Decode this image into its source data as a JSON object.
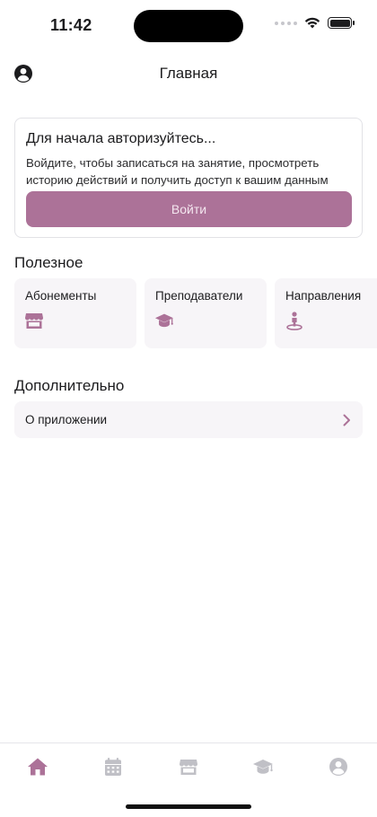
{
  "status_bar": {
    "time": "11:42"
  },
  "nav": {
    "title": "Главная",
    "profile_icon": "person-circle-icon"
  },
  "auth_card": {
    "title": "Для начала авторизуйтесь...",
    "description": "Войдите, чтобы записаться на занятие, просмотреть историю действий и получить доступ к вашим данным",
    "button_label": "Войти"
  },
  "useful": {
    "heading": "Полезное",
    "items": [
      {
        "label": "Абонементы",
        "icon": "store-icon"
      },
      {
        "label": "Преподаватели",
        "icon": "graduation-cap-icon"
      },
      {
        "label": "Направления",
        "icon": "location-person-icon"
      }
    ]
  },
  "additional": {
    "heading": "Дополнительно",
    "items": [
      {
        "label": "О приложении",
        "icon": "chevron-right-icon"
      }
    ]
  },
  "tab_bar": {
    "tabs": [
      {
        "icon": "home-icon",
        "active": true
      },
      {
        "icon": "calendar-icon",
        "active": false
      },
      {
        "icon": "store-icon",
        "active": false
      },
      {
        "icon": "graduation-cap-icon",
        "active": false
      },
      {
        "icon": "person-circle-icon",
        "active": false
      }
    ]
  },
  "colors": {
    "accent": "#ac7298",
    "accent_text": "#f4e6ef",
    "card_bg": "#f7f5f8",
    "tab_inactive": "#c0c0c6",
    "text": "#1c1c1e"
  }
}
